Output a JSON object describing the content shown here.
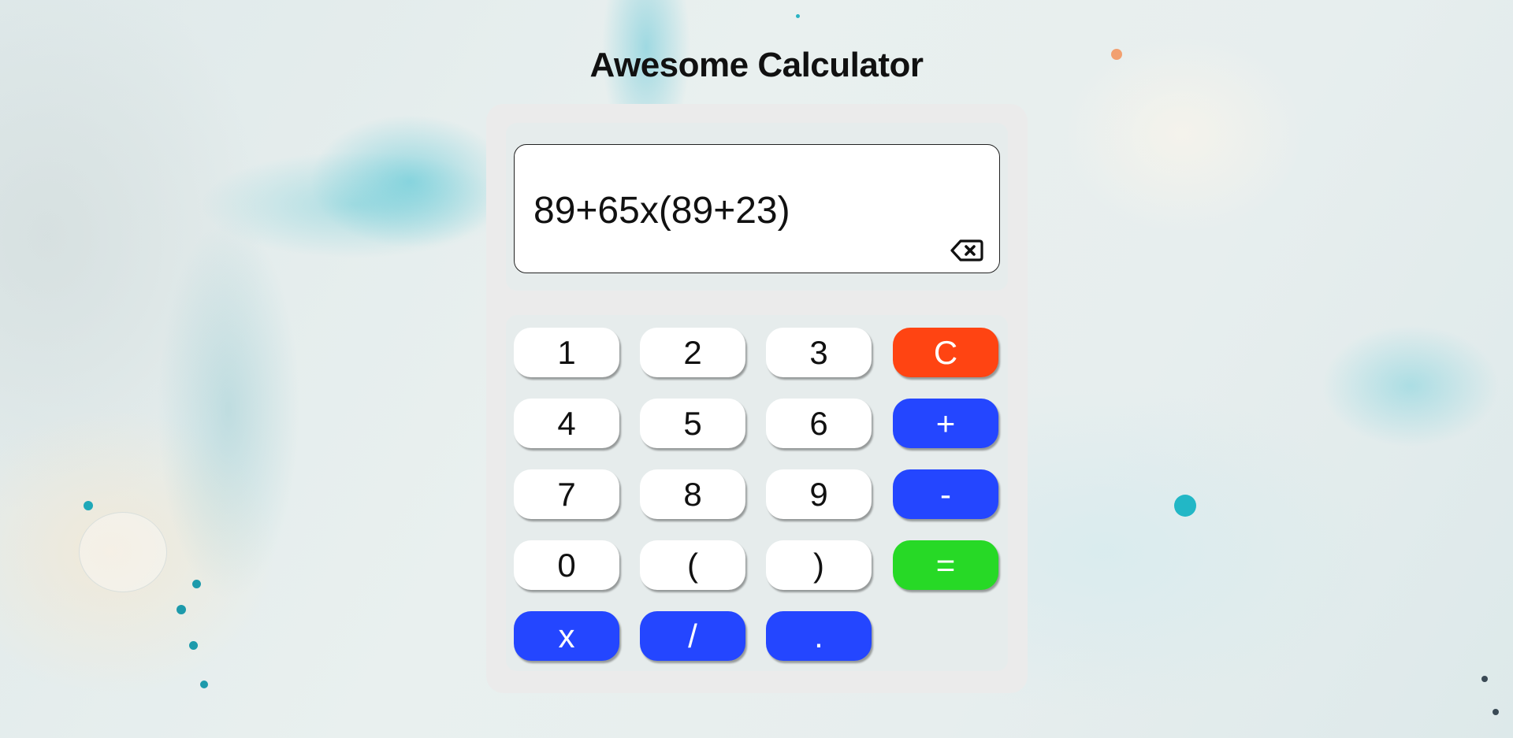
{
  "title": "Awesome Calculator",
  "display": {
    "value": "89+65x(89+23)"
  },
  "icons": {
    "backspace": "backspace-icon"
  },
  "colors": {
    "clear": "#ff4412",
    "operator": "#2446ff",
    "equals": "#27d926",
    "digit": "#ffffff"
  },
  "keys": {
    "one": "1",
    "two": "2",
    "three": "3",
    "clear": "C",
    "four": "4",
    "five": "5",
    "six": "6",
    "plus": "+",
    "seven": "7",
    "eight": "8",
    "nine": "9",
    "minus": "-",
    "zero": "0",
    "open_paren": "(",
    "close_paren": ")",
    "equals": "=",
    "multiply": "x",
    "divide": "/",
    "decimal": "."
  }
}
